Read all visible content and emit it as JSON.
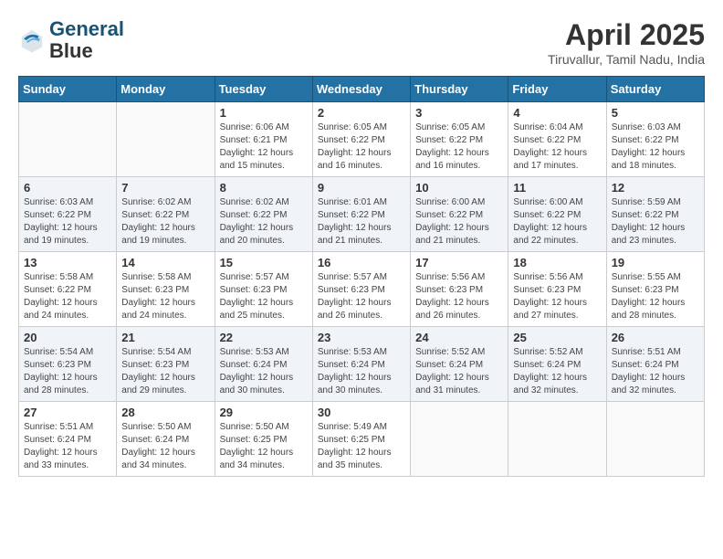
{
  "header": {
    "logo_line1": "General",
    "logo_line2": "Blue",
    "month": "April 2025",
    "location": "Tiruvallur, Tamil Nadu, India"
  },
  "days_of_week": [
    "Sunday",
    "Monday",
    "Tuesday",
    "Wednesday",
    "Thursday",
    "Friday",
    "Saturday"
  ],
  "weeks": [
    [
      {
        "day": "",
        "empty": true
      },
      {
        "day": "",
        "empty": true
      },
      {
        "day": "1",
        "sunrise": "6:06 AM",
        "sunset": "6:21 PM",
        "daylight": "12 hours and 15 minutes."
      },
      {
        "day": "2",
        "sunrise": "6:05 AM",
        "sunset": "6:22 PM",
        "daylight": "12 hours and 16 minutes."
      },
      {
        "day": "3",
        "sunrise": "6:05 AM",
        "sunset": "6:22 PM",
        "daylight": "12 hours and 16 minutes."
      },
      {
        "day": "4",
        "sunrise": "6:04 AM",
        "sunset": "6:22 PM",
        "daylight": "12 hours and 17 minutes."
      },
      {
        "day": "5",
        "sunrise": "6:03 AM",
        "sunset": "6:22 PM",
        "daylight": "12 hours and 18 minutes."
      }
    ],
    [
      {
        "day": "6",
        "sunrise": "6:03 AM",
        "sunset": "6:22 PM",
        "daylight": "12 hours and 19 minutes."
      },
      {
        "day": "7",
        "sunrise": "6:02 AM",
        "sunset": "6:22 PM",
        "daylight": "12 hours and 19 minutes."
      },
      {
        "day": "8",
        "sunrise": "6:02 AM",
        "sunset": "6:22 PM",
        "daylight": "12 hours and 20 minutes."
      },
      {
        "day": "9",
        "sunrise": "6:01 AM",
        "sunset": "6:22 PM",
        "daylight": "12 hours and 21 minutes."
      },
      {
        "day": "10",
        "sunrise": "6:00 AM",
        "sunset": "6:22 PM",
        "daylight": "12 hours and 21 minutes."
      },
      {
        "day": "11",
        "sunrise": "6:00 AM",
        "sunset": "6:22 PM",
        "daylight": "12 hours and 22 minutes."
      },
      {
        "day": "12",
        "sunrise": "5:59 AM",
        "sunset": "6:22 PM",
        "daylight": "12 hours and 23 minutes."
      }
    ],
    [
      {
        "day": "13",
        "sunrise": "5:58 AM",
        "sunset": "6:22 PM",
        "daylight": "12 hours and 24 minutes."
      },
      {
        "day": "14",
        "sunrise": "5:58 AM",
        "sunset": "6:23 PM",
        "daylight": "12 hours and 24 minutes."
      },
      {
        "day": "15",
        "sunrise": "5:57 AM",
        "sunset": "6:23 PM",
        "daylight": "12 hours and 25 minutes."
      },
      {
        "day": "16",
        "sunrise": "5:57 AM",
        "sunset": "6:23 PM",
        "daylight": "12 hours and 26 minutes."
      },
      {
        "day": "17",
        "sunrise": "5:56 AM",
        "sunset": "6:23 PM",
        "daylight": "12 hours and 26 minutes."
      },
      {
        "day": "18",
        "sunrise": "5:56 AM",
        "sunset": "6:23 PM",
        "daylight": "12 hours and 27 minutes."
      },
      {
        "day": "19",
        "sunrise": "5:55 AM",
        "sunset": "6:23 PM",
        "daylight": "12 hours and 28 minutes."
      }
    ],
    [
      {
        "day": "20",
        "sunrise": "5:54 AM",
        "sunset": "6:23 PM",
        "daylight": "12 hours and 28 minutes."
      },
      {
        "day": "21",
        "sunrise": "5:54 AM",
        "sunset": "6:23 PM",
        "daylight": "12 hours and 29 minutes."
      },
      {
        "day": "22",
        "sunrise": "5:53 AM",
        "sunset": "6:24 PM",
        "daylight": "12 hours and 30 minutes."
      },
      {
        "day": "23",
        "sunrise": "5:53 AM",
        "sunset": "6:24 PM",
        "daylight": "12 hours and 30 minutes."
      },
      {
        "day": "24",
        "sunrise": "5:52 AM",
        "sunset": "6:24 PM",
        "daylight": "12 hours and 31 minutes."
      },
      {
        "day": "25",
        "sunrise": "5:52 AM",
        "sunset": "6:24 PM",
        "daylight": "12 hours and 32 minutes."
      },
      {
        "day": "26",
        "sunrise": "5:51 AM",
        "sunset": "6:24 PM",
        "daylight": "12 hours and 32 minutes."
      }
    ],
    [
      {
        "day": "27",
        "sunrise": "5:51 AM",
        "sunset": "6:24 PM",
        "daylight": "12 hours and 33 minutes."
      },
      {
        "day": "28",
        "sunrise": "5:50 AM",
        "sunset": "6:24 PM",
        "daylight": "12 hours and 34 minutes."
      },
      {
        "day": "29",
        "sunrise": "5:50 AM",
        "sunset": "6:25 PM",
        "daylight": "12 hours and 34 minutes."
      },
      {
        "day": "30",
        "sunrise": "5:49 AM",
        "sunset": "6:25 PM",
        "daylight": "12 hours and 35 minutes."
      },
      {
        "day": "",
        "empty": true
      },
      {
        "day": "",
        "empty": true
      },
      {
        "day": "",
        "empty": true
      }
    ]
  ]
}
